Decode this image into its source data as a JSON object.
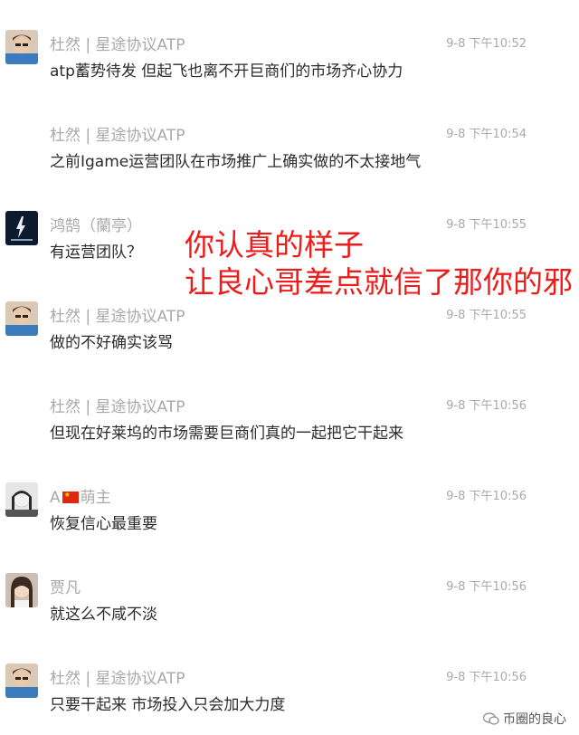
{
  "messages": [
    {
      "sender": "杜然 | 星途协议ATP",
      "time": "9-8 下午10:52",
      "text": "atp蓄势待发 但起飞也离不开巨商们的市场齐心协力",
      "avatar": "avatar-dude"
    },
    {
      "sender": "杜然 | 星途协议ATP",
      "time": "9-8 下午10:54",
      "text": "之前Igame运营团队在市场推广上确实做的不太接地气",
      "avatar": ""
    },
    {
      "sender": "鸿鹄（蘭亭）",
      "time": "9-8 下午10:55",
      "text": "有运营团队？",
      "avatar": "avatar-dark"
    },
    {
      "sender": "杜然 | 星途协议ATP",
      "time": "9-8 下午10:55",
      "text": "做的不好确实该骂",
      "avatar": "avatar-dude"
    },
    {
      "sender": "杜然 | 星途协议ATP",
      "time": "9-8 下午10:56",
      "text": "但现在好莱坞的市场需要巨商们真的一起把它干起来",
      "avatar": ""
    },
    {
      "sender_prefix": "A",
      "sender": "萌主",
      "time": "9-8 下午10:56",
      "text": "恢复信心最重要",
      "avatar": "avatar-girl-bw"
    },
    {
      "sender": "贾凡",
      "time": "9-8 下午10:56",
      "text": "就这么不咸不淡",
      "avatar": "avatar-girl"
    },
    {
      "sender": "杜然 | 星途协议ATP",
      "time": "9-8 下午10:56",
      "text": "只要干起来 市场投入只会加大力度",
      "avatar": "avatar-dude"
    }
  ],
  "overlay": {
    "line1": "你认真的样子",
    "line2": "让良心哥差点就信了那你的邪",
    "color": "#ee1b1b"
  },
  "watermark": {
    "text": "币圈的良心",
    "icon": "wechat-icon"
  }
}
